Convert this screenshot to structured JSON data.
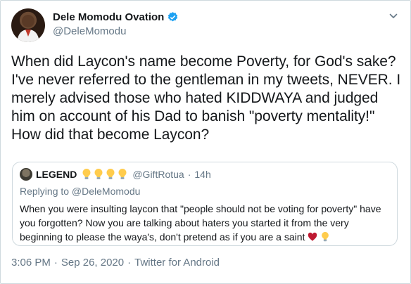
{
  "author": {
    "display_name": "Dele Momodu Ovation",
    "handle": "@DeleMomodu",
    "verified": true
  },
  "tweet": {
    "text": "When did Laycon's name become Poverty, for God's sake? I've never referred to the gentleman in my tweets, NEVER. I merely advised those who hated KIDDWAYA and judged him on account of his Dad to banish \"poverty mentality!\" How did that become Laycon?"
  },
  "quoted": {
    "display_name": "LEGEND",
    "name_emojis": [
      "lightbulb",
      "lightbulb",
      "lightbulb",
      "lightbulb"
    ],
    "handle": "@GiftRotua",
    "separator": "·",
    "time": "14h",
    "replying_to": "Replying to @DeleMomodu",
    "text": "When you were insulting laycon that \"people should not be voting for poverty\" have you forgotten? Now you are talking about haters you started it from the very beginning to please the waya's, don't pretend as if you are a saint",
    "trailing_emojis": [
      "heart",
      "lightbulb"
    ]
  },
  "footer": {
    "time": "3:06 PM",
    "sep1": "·",
    "date": "Sep 26, 2020",
    "sep2": "·",
    "source": "Twitter for Android"
  },
  "colors": {
    "verified": "#1da1f2",
    "secondary_text": "#657786",
    "border": "#cfd9de",
    "heart": "#be1931",
    "bulb": "#ffcc4d"
  }
}
